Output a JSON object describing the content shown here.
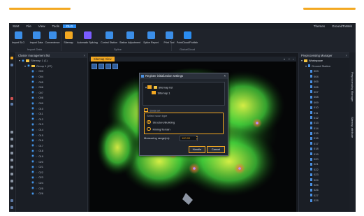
{
  "menu": {
    "items": [
      "Start",
      "File",
      "View",
      "Tools",
      "DLG"
    ],
    "active_index": 4,
    "right": [
      "Themes",
      "GroundToWeb"
    ]
  },
  "ribbon": {
    "buttons": [
      {
        "label": "Import SLG",
        "icon": "import-slg-icon",
        "color": "#3b8ee8"
      },
      {
        "label": "Import Data",
        "icon": "import-data-icon",
        "color": "#3b8ee8"
      },
      {
        "label": "Convenience",
        "icon": "convert-icon",
        "color": "#3b8ee8"
      },
      {
        "label": "Sitemap",
        "icon": "cloud-icon",
        "color": "#f3a821"
      },
      {
        "label": "Automatic Splicing",
        "icon": "auto-splice-icon",
        "color": "#7a5cff"
      },
      {
        "label": "Control Station",
        "icon": "control-station-icon",
        "color": "#3b8ee8"
      },
      {
        "label": "Station Adjustment",
        "icon": "station-adjust-icon",
        "color": "#3b8ee8"
      },
      {
        "label": "Splice Report",
        "icon": "report-icon",
        "color": "#3b8ee8"
      },
      {
        "label": "Print Tool",
        "icon": "print-icon",
        "color": "#3b8ee8"
      },
      {
        "label": "PointCloud/Publish",
        "icon": "publish-icon",
        "color": "#2a8cf0"
      }
    ],
    "groups": [
      "Import Data",
      "Splice",
      "GlobalCloud"
    ]
  },
  "left_panel": {
    "title": "Cluster management list",
    "root": "Sitemap 1 (1)",
    "group": "Group 1 (27)",
    "items": [
      "003",
      "004",
      "005",
      "006",
      "007",
      "008",
      "009",
      "010",
      "011",
      "012",
      "013",
      "014",
      "015",
      "016",
      "017",
      "018",
      "019",
      "020",
      "021",
      "022",
      "023",
      "024",
      "025",
      "026"
    ]
  },
  "viewport": {
    "tab": "Sitemap View"
  },
  "dialog": {
    "title": "Register initialization settings",
    "tree_root": "Sitemap list",
    "tree_child": "Sitemap 1",
    "section_title": "Data set",
    "subsection": "Select scan type",
    "option_1": "Structure/Building",
    "option_2": "Mining/Terrain",
    "range_label": "Measuring range(m):",
    "range_value": "100.00",
    "ok": "Handle",
    "cancel": "Cancel"
  },
  "right_panel": {
    "title": "Preprocessing Manager",
    "root": "Workspace",
    "sub": "Ground Station",
    "items": [
      "003",
      "004",
      "005",
      "006",
      "007",
      "008",
      "009",
      "010",
      "011",
      "012",
      "013",
      "014",
      "015",
      "016",
      "017",
      "018",
      "019",
      "020",
      "021",
      "022",
      "023",
      "024",
      "025",
      "026",
      "027",
      "028"
    ],
    "side_tabs": [
      "Preprocessing Manager",
      "Sitemap attribute"
    ]
  },
  "colors": {
    "accent": "#f3a821",
    "brand_blue": "#2a8cf0",
    "background": "#16191f"
  }
}
